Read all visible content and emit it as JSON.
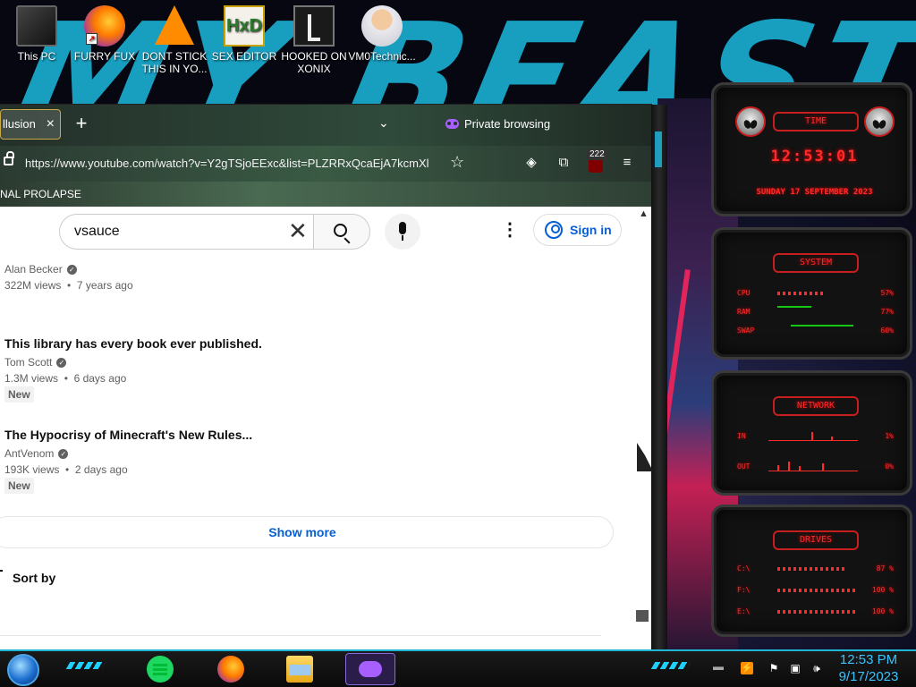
{
  "desktop": {
    "icons": [
      {
        "label": "This PC",
        "icon": "computer-icon"
      },
      {
        "label": "FURRY FUX",
        "icon": "firefox-icon"
      },
      {
        "label": "DONT STICK THIS IN YO...",
        "icon": "vlc-icon"
      },
      {
        "label": "SEX EDITOR",
        "icon": "hex-editor-icon"
      },
      {
        "label": "HOOKED ON XONIX",
        "icon": "game-icon"
      },
      {
        "label": "VM0Technic...",
        "icon": "doctor-icon"
      }
    ],
    "wallpaper_text": "MY BEAST"
  },
  "browser": {
    "tab": {
      "title": "llusion",
      "close": "×"
    },
    "new_tab": "+",
    "tab_list": "⌄",
    "private_label": "Private browsing",
    "url": "https://www.youtube.com/watch?v=Y2gTSjoEExc&list=PLZRRxQcaEjA7kcmXl",
    "bookmark_star": "☆",
    "extension_badge": "222",
    "menu": "≡",
    "bookmark": "NAL PROLAPSE"
  },
  "youtube": {
    "search_value": "vsauce",
    "sign_in": "Sign in",
    "videos": [
      {
        "title": "",
        "channel": "Alan Becker",
        "views": "322M views",
        "age": "7 years ago",
        "badge": ""
      },
      {
        "title": "This library has every book ever published.",
        "channel": "Tom Scott",
        "views": "1.3M views",
        "age": "6 days ago",
        "badge": "New"
      },
      {
        "title": "The Hypocrisy of Minecraft's New Rules...",
        "channel": "AntVenom",
        "views": "193K views",
        "age": "2 days ago",
        "badge": "New"
      }
    ],
    "show_more": "Show more",
    "sort_by": "Sort by"
  },
  "widgets": {
    "time": {
      "title": "TIME",
      "clock": "12:53:01",
      "date": "SUNDAY 17 SEPTEMBER 2023"
    },
    "system": {
      "title": "SYSTEM",
      "rows": [
        {
          "label": "CPU",
          "pct": "57%",
          "value": 0.57
        },
        {
          "label": "RAM",
          "pct": "77%",
          "value": 0.77
        },
        {
          "label": "SWAP",
          "pct": "60%",
          "value": 0.6
        }
      ]
    },
    "network": {
      "title": "NETWORK",
      "rows": [
        {
          "label": "IN",
          "pct": "1%"
        },
        {
          "label": "OUT",
          "pct": "0%"
        }
      ]
    },
    "drives": {
      "title": "DRIVES",
      "rows": [
        {
          "label": "C:\\",
          "pct": "87 %",
          "value": 0.87
        },
        {
          "label": "F:\\",
          "pct": "100 %",
          "value": 1.0
        },
        {
          "label": "E:\\",
          "pct": "100 %",
          "value": 1.0
        }
      ]
    }
  },
  "taskbar": {
    "time": "12:53 PM",
    "date": "9/17/2023",
    "apps": [
      "spotify-icon",
      "firefox-icon",
      "file-explorer-icon",
      "firefox-private-icon"
    ],
    "tray": [
      "show-hidden-icon",
      "hdd-icon",
      "flag-icon",
      "network-icon",
      "volume-icon"
    ]
  },
  "colors": {
    "accent": "#1fb6d6",
    "widget_red": "#ff2a2a",
    "yt_blue": "#065fd4"
  }
}
